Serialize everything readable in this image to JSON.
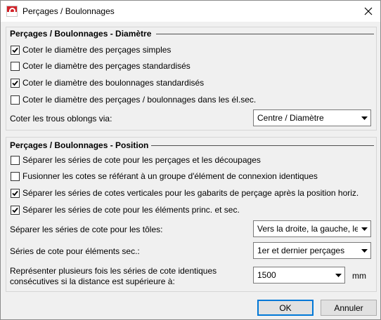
{
  "window": {
    "title": "Perçages / Boulonnages",
    "app_icon": "hicad-logo-icon",
    "close_icon": "close-icon"
  },
  "group_diametre": {
    "title": "Perçages / Boulonnages - Diamètre",
    "options": [
      {
        "label": "Coter le diamètre des perçages simples",
        "checked": true
      },
      {
        "label": "Coter le diamètre des perçages standardisés",
        "checked": false
      },
      {
        "label": "Coter le diamètre des boulonnages standardisés",
        "checked": true
      },
      {
        "label": "Coter le diamètre des perçages /  boulonnages dans les él.sec.",
        "checked": false
      }
    ],
    "oblong_label": "Coter les trous oblongs via:",
    "oblong_value": "Centre / Diamètre"
  },
  "group_position": {
    "title": "Perçages / Boulonnages - Position",
    "options": [
      {
        "label": "Séparer les séries de cote pour les perçages et les découpages",
        "checked": false
      },
      {
        "label": "Fusionner les cotes se référant à un groupe d'élément de connexion identiques",
        "checked": false
      },
      {
        "label": "Séparer les séries de cotes verticales pour les gabarits de perçage après la position horiz.",
        "checked": true
      },
      {
        "label": "Séparer les séries de cote pour les éléments princ. et sec.",
        "checked": true
      }
    ],
    "toles_label": "Séparer les séries de cote pour les tôles:",
    "toles_value": "Vers la droite, la gauche, le haut",
    "elements_label": "Séries de cote pour éléments sec.:",
    "elements_value": "1er et dernier perçages",
    "repeat_label_1": "Représenter plusieurs fois les séries de cote identiques",
    "repeat_label_2": "consécutives si la distance est supérieure à:",
    "repeat_value": "1500",
    "repeat_unit": "mm"
  },
  "buttons": {
    "ok": "OK",
    "cancel": "Annuler"
  },
  "colors": {
    "accent": "#0078d7",
    "check": "#000000",
    "dialog_bg": "#f0f0f0"
  }
}
